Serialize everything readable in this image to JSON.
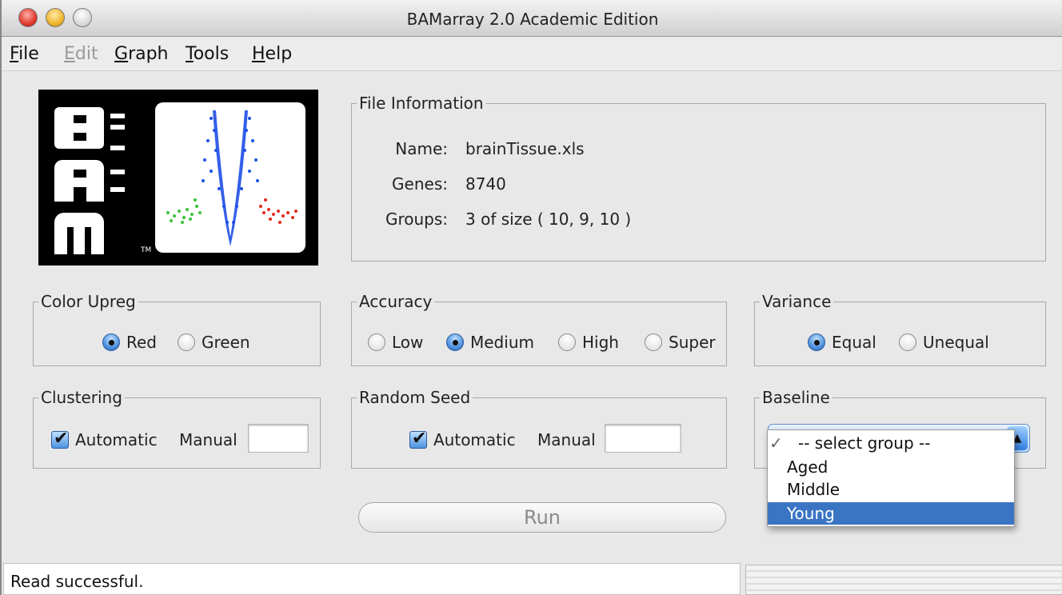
{
  "window": {
    "title": "BAMarray 2.0 Academic Edition"
  },
  "menu": {
    "file": {
      "u": "F",
      "rest": "ile"
    },
    "edit": {
      "u": "E",
      "rest": "dit"
    },
    "graph": {
      "u": "G",
      "rest": "raph"
    },
    "tools": {
      "u": "T",
      "rest": "ools"
    },
    "help": {
      "u": "H",
      "rest": "elp"
    }
  },
  "logo": {
    "tm": "TM"
  },
  "file_info": {
    "title": "File Information",
    "name_label": "Name:",
    "name_value": "brainTissue.xls",
    "genes_label": "Genes:",
    "genes_value": "8740",
    "groups_label": "Groups:",
    "groups_value": "3 of size ( 10, 9, 10 )"
  },
  "color_upreg": {
    "title": "Color Upreg",
    "options": [
      "Red",
      "Green"
    ],
    "selected": "Red"
  },
  "accuracy": {
    "title": "Accuracy",
    "options": [
      "Low",
      "Medium",
      "High",
      "Super"
    ],
    "selected": "Medium"
  },
  "variance": {
    "title": "Variance",
    "options": [
      "Equal",
      "Unequal"
    ],
    "selected": "Equal"
  },
  "clustering": {
    "title": "Clustering",
    "automatic_label": "Automatic",
    "manual_label": "Manual",
    "automatic_checked": true,
    "manual_value": ""
  },
  "random_seed": {
    "title": "Random Seed",
    "automatic_label": "Automatic",
    "manual_label": "Manual",
    "automatic_checked": true,
    "manual_value": ""
  },
  "baseline": {
    "title": "Baseline",
    "options": [
      "-- select group --",
      "Aged",
      "Middle",
      "Young"
    ],
    "checked": "-- select group --",
    "highlighted": "Young"
  },
  "run_label": "Run",
  "status": {
    "text": "Read successful."
  },
  "colors": {
    "highlight": "#3a75c4",
    "accent_blue": "#4f93e0",
    "dots_blue": "#1e4fe6",
    "dots_green": "#3cc23c",
    "dots_red": "#e22b1e"
  }
}
